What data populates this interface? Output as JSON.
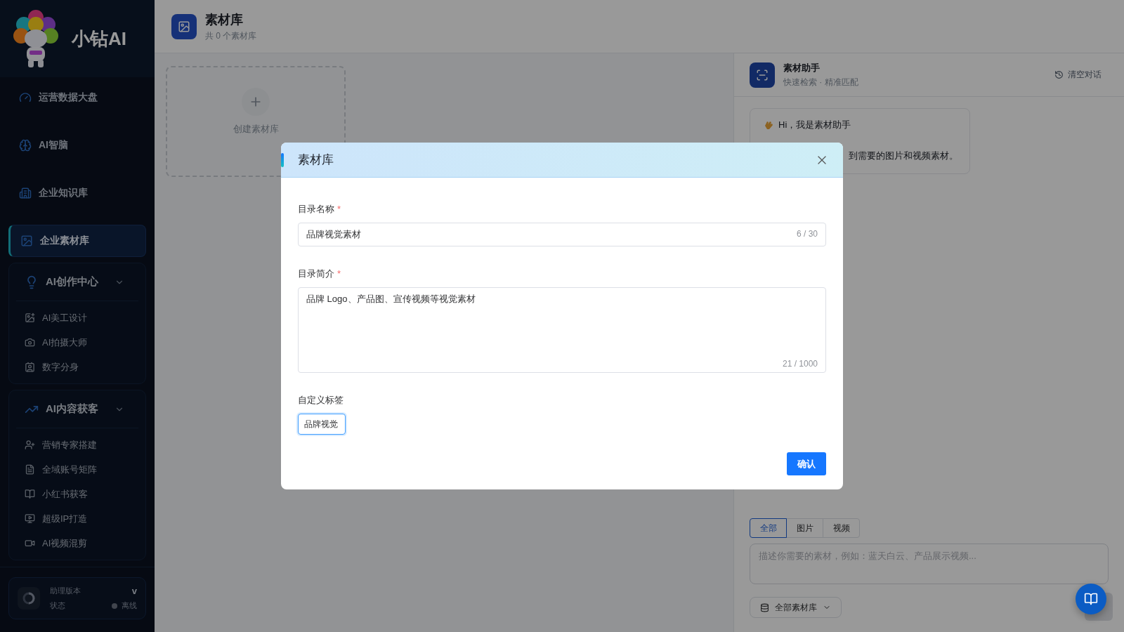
{
  "brand": {
    "name": "小钻AI"
  },
  "sidebar": {
    "items": [
      {
        "label": "运营数据大盘",
        "selected": false
      },
      {
        "label": "AI智脑",
        "selected": false
      },
      {
        "label": "企业知识库",
        "selected": false
      },
      {
        "label": "企业素材库",
        "selected": true
      }
    ],
    "groups": [
      {
        "title": "AI创作中心",
        "expanded": true,
        "items": [
          "AI美工设计",
          "AI拍摄大师",
          "数字分身"
        ]
      },
      {
        "title": "AI内容获客",
        "expanded": true,
        "items": [
          "营销专家搭建",
          "全域账号矩阵",
          "小红书获客",
          "超级IP打造",
          "AI视频混剪"
        ]
      }
    ],
    "footer": {
      "version_label": "助理版本",
      "version": "v",
      "status_label": "状态",
      "status": "离线"
    }
  },
  "page": {
    "title": "素材库",
    "subtitle": "共 0 个素材库",
    "create_label": "创建素材库"
  },
  "assistant": {
    "title": "素材助手",
    "subtitle": "快速检索 · 精准匹配",
    "clear": "清空对话",
    "greeting": "Hi，我是素材助手",
    "message_tail": "到需要的图片和视频素材。",
    "filters": [
      {
        "label": "全部",
        "selected": true
      },
      {
        "label": "图片",
        "selected": false
      },
      {
        "label": "视频",
        "selected": false
      }
    ],
    "input": {
      "placeholder": "描述你需要的素材，例如：蓝天白云、产品展示视频..."
    },
    "scope": "全部素材库"
  },
  "modal": {
    "title": "素材库",
    "fields": [
      {
        "kind": "input",
        "label": "目录名称",
        "mark": "*",
        "value": "品牌视觉素材",
        "counter": "6 / 30"
      },
      {
        "kind": "textarea",
        "label": "目录简介",
        "mark": "*",
        "value": "品牌 Logo、产品图、宣传视频等视觉素材",
        "counter": "21 / 1000"
      }
    ],
    "tags": {
      "label": "自定义标签",
      "value": "品牌视觉",
      "focused": true
    },
    "confirm": "确认"
  }
}
